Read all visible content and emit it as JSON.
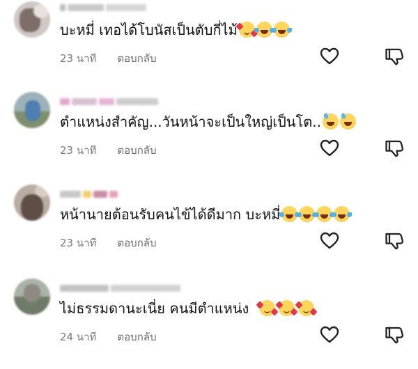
{
  "comments": [
    {
      "text": "บะหมี่ เทอได้โบนัสเป็นตับกี่ไม้",
      "emojis": [
        "smiling-face-with-hearts",
        "face-with-tears-of-joy",
        "face-with-tears-of-joy"
      ],
      "time": "23 นาที",
      "reply_label": "ตอบกลับ"
    },
    {
      "text": "ตำแหน่งสำคัญ...วันหน้าจะเป็นใหญ่เป็นโต..",
      "emojis": [
        "grinning-face-with-sweat",
        "grinning-face-with-sweat"
      ],
      "time": "23 นาที",
      "reply_label": "ตอบกลับ"
    },
    {
      "text": "หน้านายต้อนรับคนไข้ได้ดีมาก บะหมี่",
      "emojis": [
        "face-with-tears-of-joy",
        "face-with-tears-of-joy",
        "face-with-tears-of-joy",
        "face-with-tears-of-joy"
      ],
      "time": "23 นาที",
      "reply_label": "ตอบกลับ"
    },
    {
      "text": "ไม่ธรรมดานะเนี่ย คนมีตำแหน่ง",
      "emojis": [
        "smiling-face-with-hearts",
        "smiling-face-with-hearts",
        "smiling-face-with-hearts"
      ],
      "time": "24 นาที",
      "reply_label": "ตอบกลับ"
    }
  ],
  "icons": {
    "like": "heart-outline-icon",
    "dislike": "thumbs-down-outline-icon"
  },
  "colors": {
    "text": "#121212",
    "meta": "#7a7a7a",
    "icon_stroke": "#222222"
  }
}
